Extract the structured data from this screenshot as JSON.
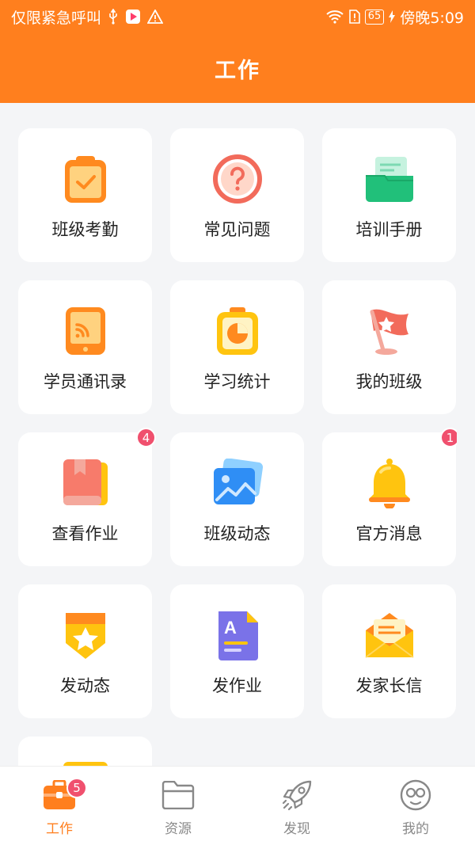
{
  "status_bar": {
    "carrier": "仅限紧急呼叫",
    "battery": "65",
    "time": "傍晚5:09",
    "icons": [
      "usb-icon",
      "video-app-icon",
      "warning-icon",
      "wifi-icon",
      "sim-alert-icon",
      "battery-icon",
      "charging-icon"
    ]
  },
  "header": {
    "title": "工作"
  },
  "tiles": [
    {
      "label": "班级考勤",
      "icon": "clipboard-check-icon"
    },
    {
      "label": "常见问题",
      "icon": "question-icon"
    },
    {
      "label": "培训手册",
      "icon": "folder-manual-icon"
    },
    {
      "label": "学员通讯录",
      "icon": "tablet-contacts-icon"
    },
    {
      "label": "学习统计",
      "icon": "pie-clock-icon"
    },
    {
      "label": "我的班级",
      "icon": "star-flag-icon"
    },
    {
      "label": "查看作业",
      "icon": "book-icon",
      "badge": "4"
    },
    {
      "label": "班级动态",
      "icon": "image-icon"
    },
    {
      "label": "官方消息",
      "icon": "bell-icon",
      "badge": "1"
    },
    {
      "label": "发动态",
      "icon": "star-badge-icon"
    },
    {
      "label": "发作业",
      "icon": "document-a-icon"
    },
    {
      "label": "发家长信",
      "icon": "envelope-icon"
    }
  ],
  "tab_bar": {
    "items": [
      {
        "label": "工作",
        "icon": "briefcase-icon",
        "active": true,
        "badge": "5"
      },
      {
        "label": "资源",
        "icon": "folder-icon",
        "active": false
      },
      {
        "label": "发现",
        "icon": "rocket-icon",
        "active": false
      },
      {
        "label": "我的",
        "icon": "profile-face-icon",
        "active": false
      }
    ]
  },
  "colors": {
    "brand": "#ff7f1e",
    "badge": "#f0506e",
    "background": "#f4f5f7"
  }
}
